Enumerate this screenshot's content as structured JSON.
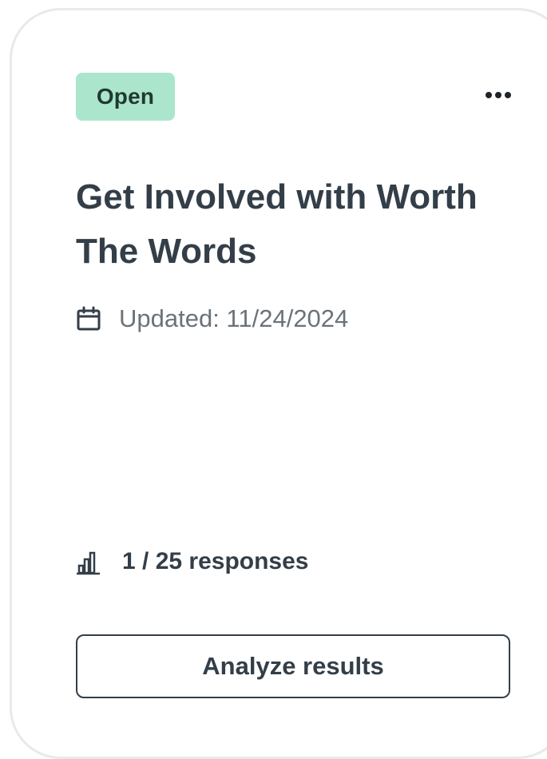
{
  "card": {
    "status_badge": "Open",
    "menu_icon": "more-horizontal-icon",
    "title": "Get Involved with Worth The Words",
    "updated_icon": "calendar-icon",
    "updated_text": "Updated: 11/24/2024",
    "responses_icon": "bar-chart-icon",
    "responses_text": "1 / 25 responses",
    "analyze_button_label": "Analyze results"
  },
  "colors": {
    "badge_background": "#abe6cc",
    "text_primary": "#333e48",
    "text_secondary": "#6b7279",
    "card_border": "#e9e9ea"
  }
}
